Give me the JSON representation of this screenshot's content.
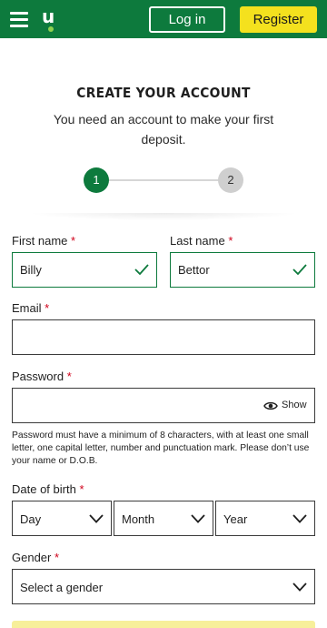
{
  "header": {
    "logo_letter": "u",
    "login_label": "Log in",
    "register_label": "Register",
    "colors": {
      "bar": "#0d7a3d",
      "register": "#f4e11e"
    }
  },
  "title": "CREATE YOUR ACCOUNT",
  "subtitle": "You need an account to make your first deposit.",
  "stepper": {
    "steps": [
      "1",
      "2"
    ],
    "current_step": 1
  },
  "form": {
    "first_name": {
      "label": "First name",
      "required": "*",
      "value": "Billy"
    },
    "last_name": {
      "label": "Last name",
      "required": "*",
      "value": "Bettor"
    },
    "email": {
      "label": "Email",
      "required": "*",
      "value": ""
    },
    "password": {
      "label": "Password",
      "required": "*",
      "value": "",
      "toggle_label": "Show"
    },
    "password_hint": "Password must have a minimum of 8 characters, with at least one small letter, one capital letter, number and punctuation mark. Please don’t use your name or D.O.B.",
    "dob": {
      "label": "Date of birth",
      "required": "*",
      "day": "Day",
      "month": "Month",
      "year": "Year"
    },
    "gender": {
      "label": "Gender",
      "required": "*",
      "placeholder": "Select a gender"
    }
  },
  "icons": {
    "menu": "hamburger-icon",
    "valid": "checkmark-icon",
    "eye": "eye-icon",
    "dropdown": "chevron-down-icon"
  }
}
